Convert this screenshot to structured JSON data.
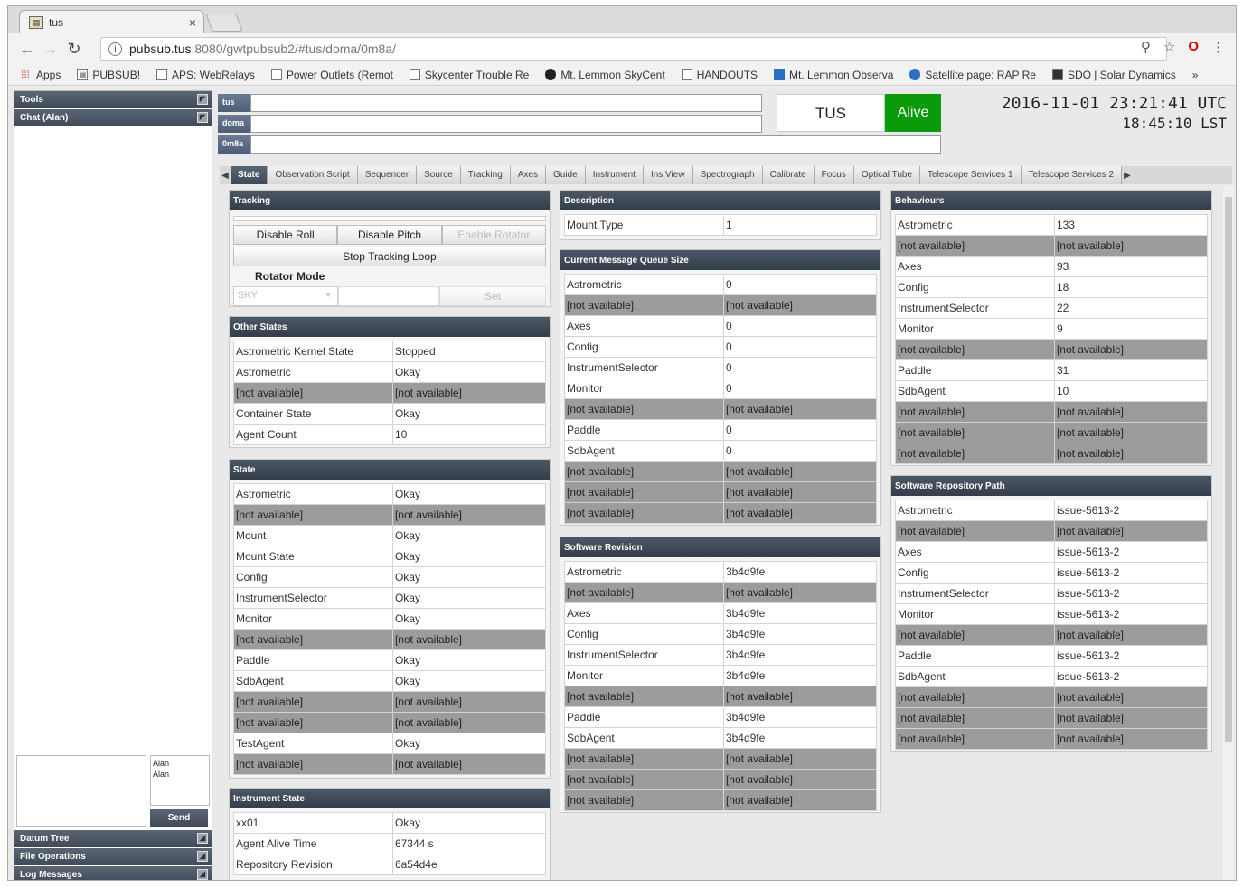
{
  "browser": {
    "tab_title": "tus",
    "url_host": "pubsub.tus",
    "url_path": ":8080/gwtpubsub2/#tus/doma/0m8a/",
    "bookmarks": [
      "Apps",
      "PUBSUB!",
      "APS: WebRelays",
      "Power Outlets (Remot",
      "Skycenter Trouble Re",
      "Mt. Lemmon SkyCent",
      "HANDOUTS",
      "Mt. Lemmon Observa",
      "Satellite page: RAP Re",
      "SDO | Solar Dynamics"
    ],
    "bookmarks_more": "»"
  },
  "sidebar": {
    "top": [
      "Tools",
      "Chat (Alan)"
    ],
    "chat_users": [
      "Alan",
      "Alan"
    ],
    "send_label": "Send",
    "bottom": [
      "Datum Tree",
      "File Operations",
      "Log Messages"
    ]
  },
  "header": {
    "keys": [
      "tus",
      "doma",
      "0m8a"
    ],
    "site": "TUS",
    "status": "Alive",
    "utc": "2016-11-01 23:21:41 UTC",
    "lst": "18:45:10 LST"
  },
  "tabs": [
    "State",
    "Observation Script",
    "Sequencer",
    "Source",
    "Tracking",
    "Axes",
    "Guide",
    "Instrument",
    "Ins View",
    "Spectrograph",
    "Calibrate",
    "Focus",
    "Optical Tube",
    "Telescope Services 1",
    "Telescope Services 2"
  ],
  "tracking": {
    "title": "Tracking",
    "buttons": [
      "Disable Roll",
      "Disable Pitch",
      "Enable Rotator"
    ],
    "stop_label": "Stop Tracking Loop",
    "rotator_mode_label": "Rotator Mode",
    "rotator_select": "SKY",
    "set_label": "Set"
  },
  "other_states": {
    "title": "Other States",
    "rows": [
      [
        "Astrometric Kernel State",
        "Stopped"
      ],
      [
        "Astrometric",
        "Okay"
      ],
      [
        "[not available]",
        "[not available]"
      ],
      [
        "Container State",
        "Okay"
      ],
      [
        "Agent Count",
        "10"
      ]
    ]
  },
  "state": {
    "title": "State",
    "rows": [
      [
        "Astrometric",
        "Okay"
      ],
      [
        "[not available]",
        "[not available]"
      ],
      [
        "Mount",
        "Okay"
      ],
      [
        "Mount State",
        "Okay"
      ],
      [
        "Config",
        "Okay"
      ],
      [
        "InstrumentSelector",
        "Okay"
      ],
      [
        "Monitor",
        "Okay"
      ],
      [
        "[not available]",
        "[not available]"
      ],
      [
        "Paddle",
        "Okay"
      ],
      [
        "SdbAgent",
        "Okay"
      ],
      [
        "[not available]",
        "[not available]"
      ],
      [
        "[not available]",
        "[not available]"
      ],
      [
        "TestAgent",
        "Okay"
      ],
      [
        "[not available]",
        "[not available]"
      ]
    ]
  },
  "instrument_state": {
    "title": "Instrument State",
    "rows": [
      [
        "xx01",
        "Okay"
      ],
      [
        "Agent Alive Time",
        "67344 s"
      ],
      [
        "Repository Revision",
        "6a54d4e"
      ]
    ]
  },
  "description": {
    "title": "Description",
    "rows": [
      [
        "Mount Type",
        "1"
      ]
    ]
  },
  "queue": {
    "title": "Current Message Queue Size",
    "rows": [
      [
        "Astrometric",
        "0"
      ],
      [
        "[not available]",
        "[not available]"
      ],
      [
        "Axes",
        "0"
      ],
      [
        "Config",
        "0"
      ],
      [
        "InstrumentSelector",
        "0"
      ],
      [
        "Monitor",
        "0"
      ],
      [
        "[not available]",
        "[not available]"
      ],
      [
        "Paddle",
        "0"
      ],
      [
        "SdbAgent",
        "0"
      ],
      [
        "[not available]",
        "[not available]"
      ],
      [
        "[not available]",
        "[not available]"
      ],
      [
        "[not available]",
        "[not available]"
      ]
    ]
  },
  "software_revision": {
    "title": "Software Revision",
    "rows": [
      [
        "Astrometric",
        "3b4d9fe"
      ],
      [
        "[not available]",
        "[not available]"
      ],
      [
        "Axes",
        "3b4d9fe"
      ],
      [
        "Config",
        "3b4d9fe"
      ],
      [
        "InstrumentSelector",
        "3b4d9fe"
      ],
      [
        "Monitor",
        "3b4d9fe"
      ],
      [
        "[not available]",
        "[not available]"
      ],
      [
        "Paddle",
        "3b4d9fe"
      ],
      [
        "SdbAgent",
        "3b4d9fe"
      ],
      [
        "[not available]",
        "[not available]"
      ],
      [
        "[not available]",
        "[not available]"
      ],
      [
        "[not available]",
        "[not available]"
      ]
    ]
  },
  "behaviours": {
    "title": "Behaviours",
    "rows": [
      [
        "Astrometric",
        "133"
      ],
      [
        "[not available]",
        "[not available]"
      ],
      [
        "Axes",
        "93"
      ],
      [
        "Config",
        "18"
      ],
      [
        "InstrumentSelector",
        "22"
      ],
      [
        "Monitor",
        "9"
      ],
      [
        "[not available]",
        "[not available]"
      ],
      [
        "Paddle",
        "31"
      ],
      [
        "SdbAgent",
        "10"
      ],
      [
        "[not available]",
        "[not available]"
      ],
      [
        "[not available]",
        "[not available]"
      ],
      [
        "[not available]",
        "[not available]"
      ]
    ]
  },
  "repo_path": {
    "title": "Software Repository Path",
    "rows": [
      [
        "Astrometric",
        "issue-5613-2"
      ],
      [
        "[not available]",
        "[not available]"
      ],
      [
        "Axes",
        "issue-5613-2"
      ],
      [
        "Config",
        "issue-5613-2"
      ],
      [
        "InstrumentSelector",
        "issue-5613-2"
      ],
      [
        "Monitor",
        "issue-5613-2"
      ],
      [
        "[not available]",
        "[not available]"
      ],
      [
        "Paddle",
        "issue-5613-2"
      ],
      [
        "SdbAgent",
        "issue-5613-2"
      ],
      [
        "[not available]",
        "[not available]"
      ],
      [
        "[not available]",
        "[not available]"
      ],
      [
        "[not available]",
        "[not available]"
      ]
    ]
  },
  "colors": {
    "okay": "#18ec18",
    "stopped": "#ffff00",
    "alive": "#0a9a0a",
    "unavailable": "#9c9c9c"
  }
}
